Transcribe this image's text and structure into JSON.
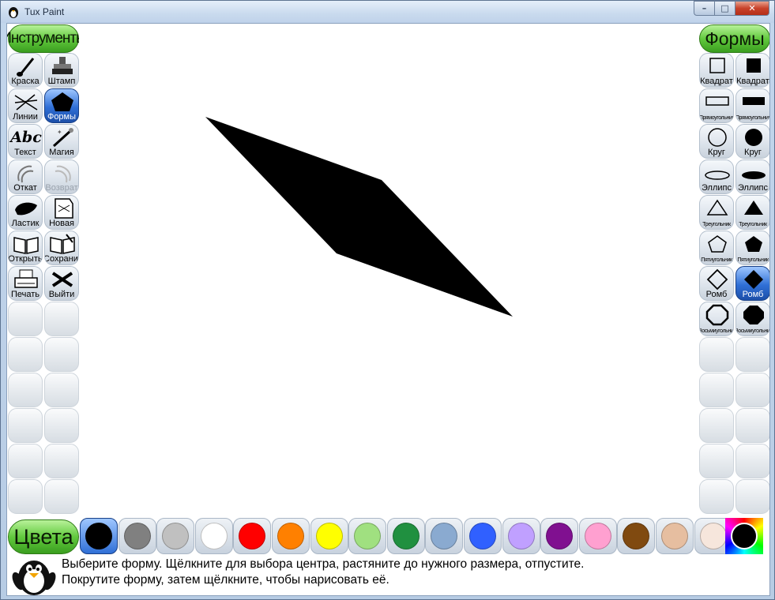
{
  "window": {
    "title": "Tux Paint",
    "min_label": "–",
    "max_label": "□",
    "close_label": "✕"
  },
  "tools": {
    "header": "Инструменты",
    "items": [
      {
        "label": "Краска",
        "icon": "brush-icon"
      },
      {
        "label": "Штамп",
        "icon": "stamp-icon"
      },
      {
        "label": "Линии",
        "icon": "lines-icon"
      },
      {
        "label": "Формы",
        "icon": "pentagon-icon",
        "selected": true
      },
      {
        "label": "Текст",
        "icon": "text-abc-icon",
        "glyph": "Abc"
      },
      {
        "label": "Магия",
        "icon": "magic-wand-icon"
      },
      {
        "label": "Откат",
        "icon": "undo-icon"
      },
      {
        "label": "Возврат",
        "icon": "redo-icon",
        "disabled": true
      },
      {
        "label": "Ластик",
        "icon": "eraser-icon"
      },
      {
        "label": "Новая",
        "icon": "new-page-icon"
      },
      {
        "label": "Открыть",
        "icon": "open-book-icon"
      },
      {
        "label": "Сохранить",
        "icon": "save-book-icon"
      },
      {
        "label": "Печать",
        "icon": "printer-icon"
      },
      {
        "label": "Выйти",
        "icon": "quit-icon"
      }
    ]
  },
  "shapes": {
    "header": "Формы",
    "items": [
      {
        "label": "Квадрат",
        "icon": "square-outline-icon"
      },
      {
        "label": "Квадрат",
        "icon": "square-filled-icon"
      },
      {
        "label": "Прямоугольник",
        "icon": "rectangle-outline-icon"
      },
      {
        "label": "Прямоугольник",
        "icon": "rectangle-filled-icon"
      },
      {
        "label": "Круг",
        "icon": "circle-outline-icon"
      },
      {
        "label": "Круг",
        "icon": "circle-filled-icon"
      },
      {
        "label": "Эллипс",
        "icon": "ellipse-outline-icon"
      },
      {
        "label": "Эллипс",
        "icon": "ellipse-filled-icon"
      },
      {
        "label": "Треугольник",
        "icon": "triangle-outline-icon"
      },
      {
        "label": "Треугольник",
        "icon": "triangle-filled-icon"
      },
      {
        "label": "Пятиугольник",
        "icon": "pentagon-outline-icon"
      },
      {
        "label": "Пятиугольник",
        "icon": "pentagon-filled-icon"
      },
      {
        "label": "Ромб",
        "icon": "diamond-outline-icon"
      },
      {
        "label": "Ромб",
        "icon": "diamond-filled-icon",
        "selected": true
      },
      {
        "label": "Восьмиугольник",
        "icon": "octagon-outline-icon"
      },
      {
        "label": "Восьмиугольник",
        "icon": "octagon-filled-icon"
      }
    ]
  },
  "colors": {
    "header": "Цвета",
    "swatches": [
      "#000000",
      "#808080",
      "#c0c0c0",
      "#ffffff",
      "#ff0000",
      "#ff8000",
      "#ffff00",
      "#a0e080",
      "#209040",
      "#8aaad0",
      "#3060ff",
      "#c0a0ff",
      "#801090",
      "#ffa0d0",
      "#804a10",
      "#e6bea0",
      "#f6e6dc"
    ],
    "selected_index": 0,
    "picker_icon": "color-picker-icon"
  },
  "canvas": {
    "shape": "filled-rhombus",
    "fill": "#000000"
  },
  "help_text": "Выберите форму. Щёлкните для выбора центра, растяните до нужного размера, отпустите.\nПокрутите форму, затем щёлкните, чтобы нарисовать её.",
  "mascot": "tux-penguin-icon"
}
